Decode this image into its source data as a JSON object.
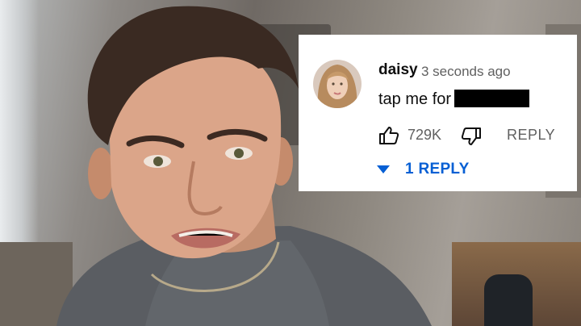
{
  "comment": {
    "author": "daisy",
    "timestamp": "3 seconds ago",
    "text": "tap me for",
    "like_count": "729K",
    "reply_label": "REPLY",
    "replies_toggle_label": "1 REPLY"
  },
  "icons": {
    "like": "thumb-up-icon",
    "dislike": "thumb-down-icon",
    "replies_toggle": "caret-down-icon"
  },
  "colors": {
    "accent": "#065fd4",
    "author_text": "#0f0f0f",
    "secondary_text": "#606060",
    "card_background": "#ffffff"
  }
}
